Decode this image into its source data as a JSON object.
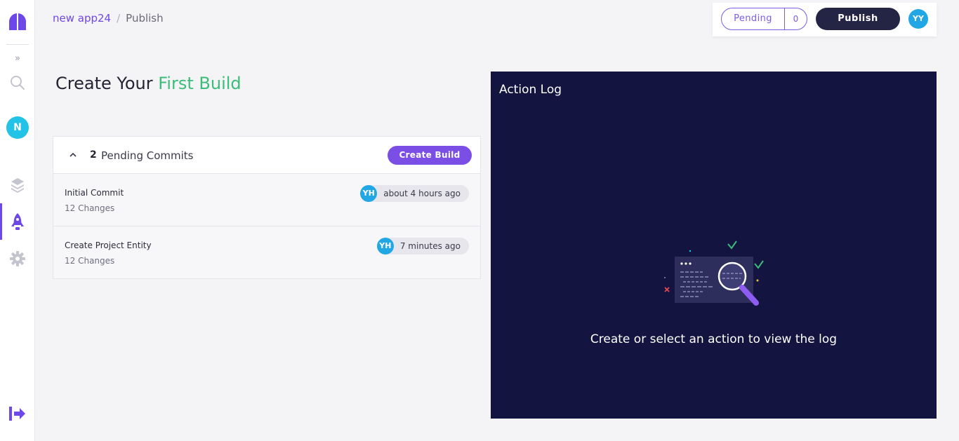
{
  "sidebar": {
    "expand_label": "»",
    "workspace_avatar": "N"
  },
  "breadcrumb": {
    "app": "new app24",
    "separator": "/",
    "page": "Publish"
  },
  "toolbar": {
    "pending_label": "Pending",
    "pending_count": "0",
    "publish_label": "Publish",
    "user_initials": "YY"
  },
  "main": {
    "title_prefix": "Create Your",
    "title_accent": "First Build",
    "title_accent_color": "#3bbd79"
  },
  "commits": {
    "pending_count": "2",
    "pending_label": "Pending Commits",
    "create_build_label": "Create Build",
    "items": [
      {
        "title": "Initial Commit",
        "changes": "12 Changes",
        "author_initials": "YH",
        "time": "about 4 hours ago"
      },
      {
        "title": "Create Project Entity",
        "changes": "12 Changes",
        "author_initials": "YH",
        "time": "7 minutes ago"
      }
    ]
  },
  "action_log": {
    "title": "Action Log",
    "empty_message": "Create or select an action to view the log"
  },
  "colors": {
    "accent": "#6e47e8",
    "publish_bg": "#242444",
    "log_bg": "#141441",
    "avatar_bg": "#22a7e6"
  }
}
